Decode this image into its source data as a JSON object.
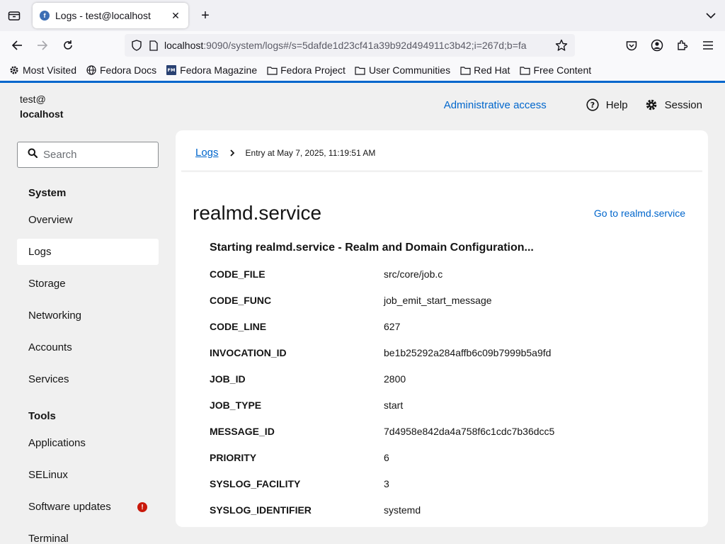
{
  "browser": {
    "tab_title": "Logs - test@localhost",
    "url_host": "localhost",
    "url_rest": ":9090/system/logs#/s=5dafde1d23cf41a39b92d494911c3b42;i=267d;b=fa",
    "bookmarks": [
      {
        "label": "Most Visited",
        "icon": "gear-icon"
      },
      {
        "label": "Fedora Docs",
        "icon": "globe-icon"
      },
      {
        "label": "Fedora Magazine",
        "icon": "fm-icon"
      },
      {
        "label": "Fedora Project",
        "icon": "folder-icon"
      },
      {
        "label": "User Communities",
        "icon": "folder-icon"
      },
      {
        "label": "Red Hat",
        "icon": "folder-icon"
      },
      {
        "label": "Free Content",
        "icon": "folder-icon"
      }
    ]
  },
  "header": {
    "user": "test@",
    "host": "localhost",
    "admin_access": "Administrative access",
    "help": "Help",
    "session": "Session"
  },
  "sidebar": {
    "search_placeholder": "Search",
    "section_system": "System",
    "system_items": [
      "Overview",
      "Logs",
      "Storage",
      "Networking",
      "Accounts",
      "Services"
    ],
    "active_item": "Logs",
    "section_tools": "Tools",
    "tools_items": [
      "Applications",
      "SELinux",
      "Software updates",
      "Terminal"
    ],
    "alert_item": "Software updates",
    "alert_symbol": "!"
  },
  "entry": {
    "breadcrumb_link": "Logs",
    "breadcrumb_current": "Entry at May 7, 2025, 11:19:51 AM",
    "title": "realmd.service",
    "goto_link": "Go to realmd.service",
    "message": "Starting realmd.service - Realm and Domain Configuration...",
    "fields": [
      {
        "key": "CODE_FILE",
        "value": "src/core/job.c"
      },
      {
        "key": "CODE_FUNC",
        "value": "job_emit_start_message"
      },
      {
        "key": "CODE_LINE",
        "value": "627"
      },
      {
        "key": "INVOCATION_ID",
        "value": "be1b25292a284affb6c09b7999b5a9fd"
      },
      {
        "key": "JOB_ID",
        "value": "2800"
      },
      {
        "key": "JOB_TYPE",
        "value": "start"
      },
      {
        "key": "MESSAGE_ID",
        "value": "7d4958e842da4a758f6c1cdc7b36dcc5"
      },
      {
        "key": "PRIORITY",
        "value": "6"
      },
      {
        "key": "SYSLOG_FACILITY",
        "value": "3"
      },
      {
        "key": "SYSLOG_IDENTIFIER",
        "value": "systemd"
      }
    ]
  },
  "colors": {
    "accent": "#0066cc",
    "alert": "#c9190b",
    "page_bg": "#f0f0f0"
  }
}
